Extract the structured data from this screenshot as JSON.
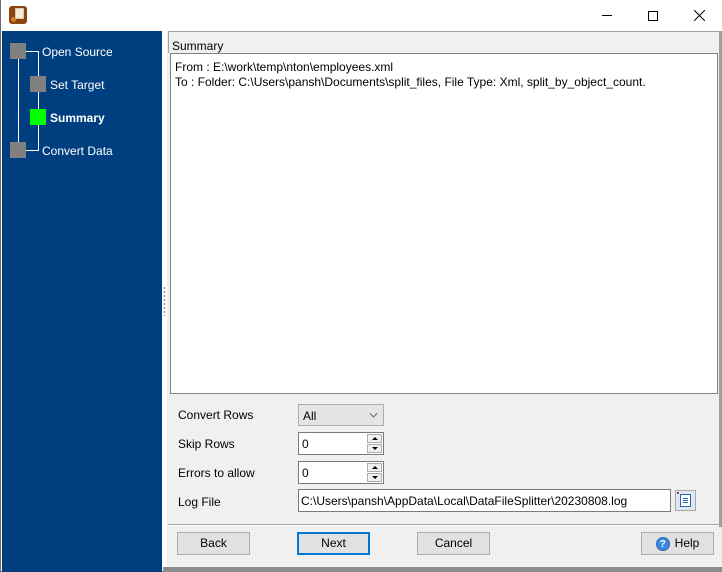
{
  "window": {
    "title": "",
    "icon": "app-icon",
    "controls": {
      "minimize": "minimize-icon",
      "maximize": "maximize-icon",
      "close": "close-icon"
    }
  },
  "wizard_steps": [
    {
      "label": "Open Source",
      "state": "pending",
      "level": 0
    },
    {
      "label": "Set Target",
      "state": "pending",
      "level": 1
    },
    {
      "label": "Summary",
      "state": "active",
      "level": 1
    },
    {
      "label": "Convert Data",
      "state": "pending",
      "level": 0
    }
  ],
  "colors": {
    "sidebar_bg": "#003f7f",
    "step_pending": "#808080",
    "step_active": "#00ff00",
    "default_button_border": "#0078d7"
  },
  "summary": {
    "header": "Summary",
    "lines": [
      "From : E:\\work\\temp\\nton\\employees.xml",
      "To : Folder: C:\\Users\\pansh\\Documents\\split_files, File Type: Xml, split_by_object_count."
    ]
  },
  "form": {
    "convert_rows": {
      "label": "Convert Rows",
      "value": "All"
    },
    "skip_rows": {
      "label": "Skip Rows",
      "value": "0"
    },
    "errors_to_allow": {
      "label": "Errors to allow",
      "value": "0"
    },
    "log_file": {
      "label": "Log File",
      "value": "C:\\Users\\pansh\\AppData\\Local\\DataFileSplitter\\20230808.log"
    }
  },
  "buttons": {
    "back": "Back",
    "next": "Next",
    "cancel": "Cancel",
    "help": "Help"
  }
}
